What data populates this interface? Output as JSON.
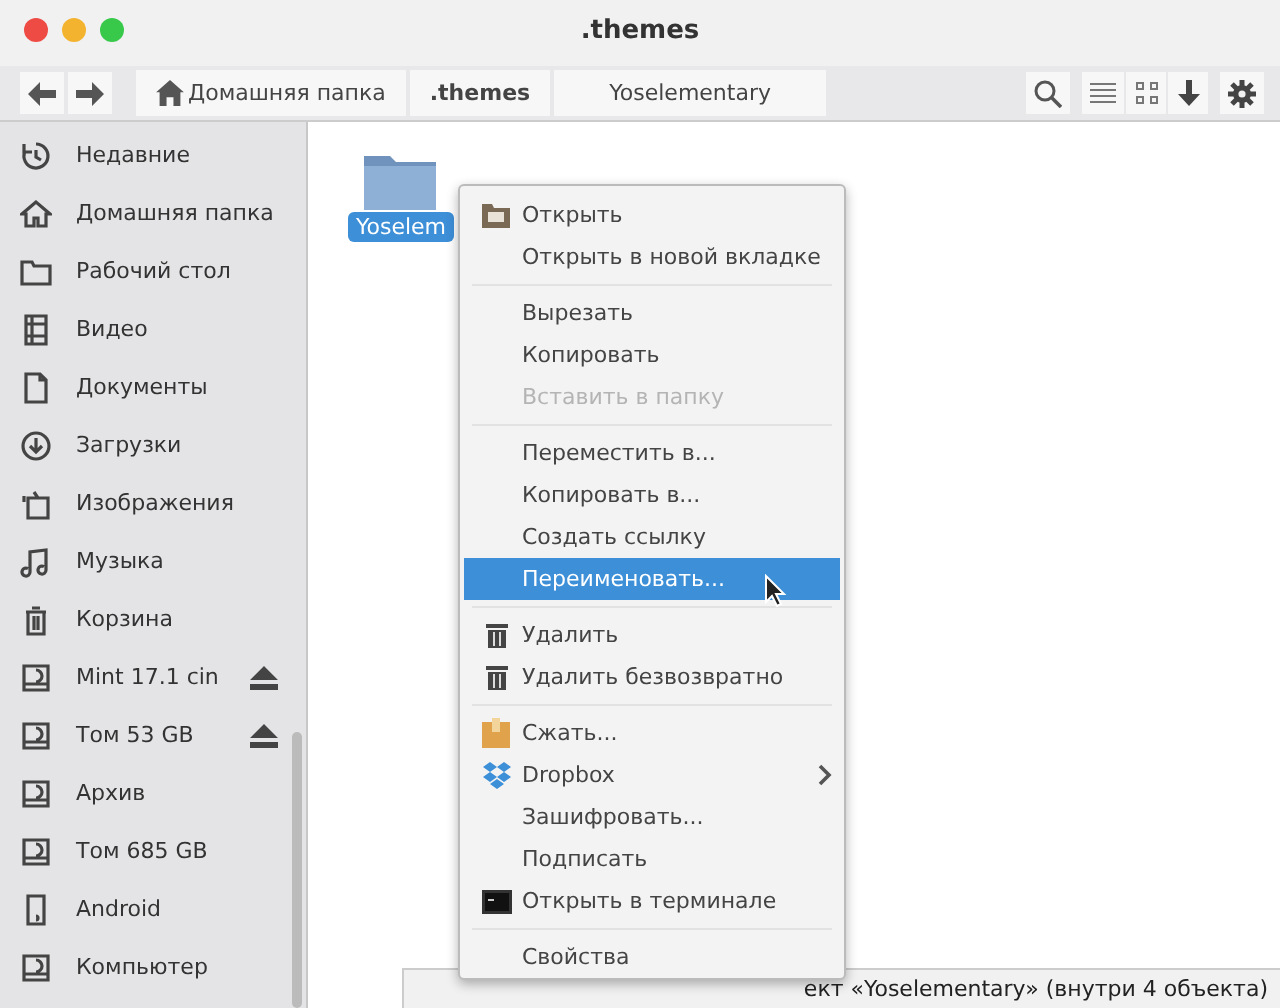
{
  "window": {
    "title": ".themes"
  },
  "toolbar": {
    "path": [
      {
        "label": "Домашняя папка",
        "selected": false
      },
      {
        "label": ".themes",
        "selected": true
      },
      {
        "label": "Yoselementary",
        "selected": false
      }
    ]
  },
  "sidebar": {
    "items": [
      {
        "label": "Недавние",
        "kind": "recent",
        "eject": false
      },
      {
        "label": "Домашняя папка",
        "kind": "home",
        "eject": false
      },
      {
        "label": "Рабочий стол",
        "kind": "desktop",
        "eject": false
      },
      {
        "label": "Видео",
        "kind": "video",
        "eject": false
      },
      {
        "label": "Документы",
        "kind": "document",
        "eject": false
      },
      {
        "label": "Загрузки",
        "kind": "download",
        "eject": false
      },
      {
        "label": "Изображения",
        "kind": "image",
        "eject": false
      },
      {
        "label": "Музыка",
        "kind": "music",
        "eject": false
      },
      {
        "label": "Корзина",
        "kind": "trash",
        "eject": false
      },
      {
        "label": "Mint 17.1 cin",
        "kind": "drive",
        "eject": true
      },
      {
        "label": "Том 53 GB",
        "kind": "drive",
        "eject": true
      },
      {
        "label": "Архив",
        "kind": "drive",
        "eject": false
      },
      {
        "label": "Том 685 GB",
        "kind": "drive",
        "eject": false
      },
      {
        "label": "Android",
        "kind": "phone",
        "eject": false
      },
      {
        "label": "Компьютер",
        "kind": "drive",
        "eject": false
      }
    ]
  },
  "files": [
    {
      "name": "Yoselem",
      "selected": true
    }
  ],
  "context_menu": [
    {
      "kind": "item",
      "label": "Открыть",
      "disabled": false,
      "selected": false
    },
    {
      "kind": "item",
      "label": "Открыть в новой вкладке",
      "disabled": false,
      "selected": false
    },
    {
      "kind": "separator"
    },
    {
      "kind": "item",
      "label": "Вырезать",
      "disabled": false,
      "selected": false
    },
    {
      "kind": "item",
      "label": "Копировать",
      "disabled": false,
      "selected": false
    },
    {
      "kind": "item",
      "label": "Вставить в папку",
      "disabled": true,
      "selected": false
    },
    {
      "kind": "separator"
    },
    {
      "kind": "item",
      "label": "Переместить в...",
      "disabled": false,
      "selected": false
    },
    {
      "kind": "item",
      "label": "Копировать в...",
      "disabled": false,
      "selected": false
    },
    {
      "kind": "item",
      "label": "Создать ссылку",
      "disabled": false,
      "selected": false
    },
    {
      "kind": "item",
      "label": "Переименовать...",
      "disabled": false,
      "selected": true
    },
    {
      "kind": "separator"
    },
    {
      "kind": "item",
      "label": "Удалить",
      "disabled": false,
      "selected": false
    },
    {
      "kind": "item",
      "label": "Удалить безвозвратно",
      "disabled": false,
      "selected": false
    },
    {
      "kind": "separator"
    },
    {
      "kind": "item",
      "label": "Сжать...",
      "disabled": false,
      "selected": false
    },
    {
      "kind": "submenu",
      "label": "Dropbox",
      "disabled": false,
      "selected": false
    },
    {
      "kind": "item",
      "label": "Зашифровать...",
      "disabled": false,
      "selected": false
    },
    {
      "kind": "item",
      "label": "Подписать",
      "disabled": false,
      "selected": false
    },
    {
      "kind": "item",
      "label": "Открыть в терминале",
      "disabled": false,
      "selected": false
    },
    {
      "kind": "separator"
    },
    {
      "kind": "item",
      "label": "Свойства",
      "disabled": false,
      "selected": false
    }
  ],
  "status_bar": "ект «Yoselementary»  (внутри 4 объекта)"
}
